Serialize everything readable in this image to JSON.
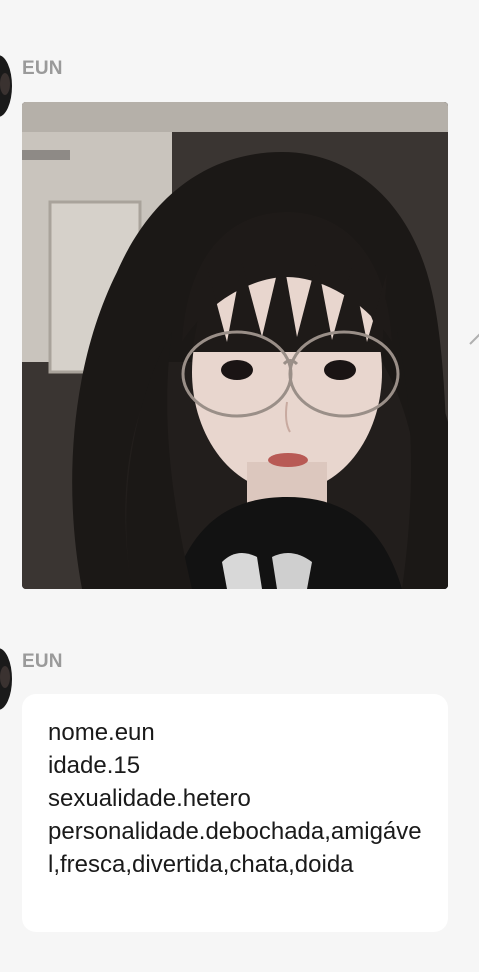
{
  "messages": [
    {
      "sender": "EUN",
      "type": "image",
      "image_alt": "selfie"
    },
    {
      "sender": "EUN",
      "type": "text",
      "text": "nome.eun\nidade.15\nsexualidade.hetero\npersonalidade.debochada,amigável,fresca,divertida,chata,doida"
    }
  ],
  "icons": {
    "avatar": "avatar",
    "side_action": "reply-arrow-icon"
  },
  "colors": {
    "background": "#f6f6f6",
    "sender_name": "#9a9a9a",
    "bubble": "#ffffff",
    "text": "#1a1a1a"
  }
}
